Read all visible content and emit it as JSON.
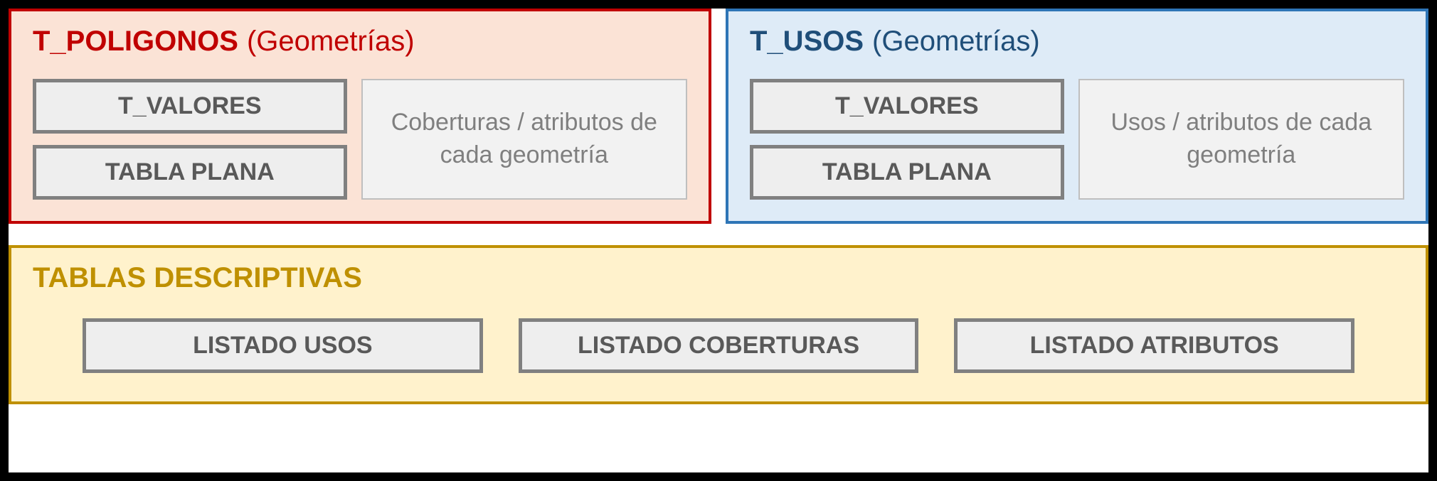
{
  "poligonos": {
    "name": "T_POLIGONOS",
    "suffix": "(Geometrías)",
    "tables": [
      "T_VALORES",
      "TABLA PLANA"
    ],
    "desc": "Coberturas / atributos de cada geometría"
  },
  "usos": {
    "name": "T_USOS",
    "suffix": "(Geometrías)",
    "tables": [
      "T_VALORES",
      "TABLA PLANA"
    ],
    "desc": "Usos / atributos de cada geometría"
  },
  "descriptivas": {
    "title": "TABLAS DESCRIPTIVAS",
    "items": [
      "LISTADO USOS",
      "LISTADO COBERTURAS",
      "LISTADO ATRIBUTOS"
    ]
  }
}
